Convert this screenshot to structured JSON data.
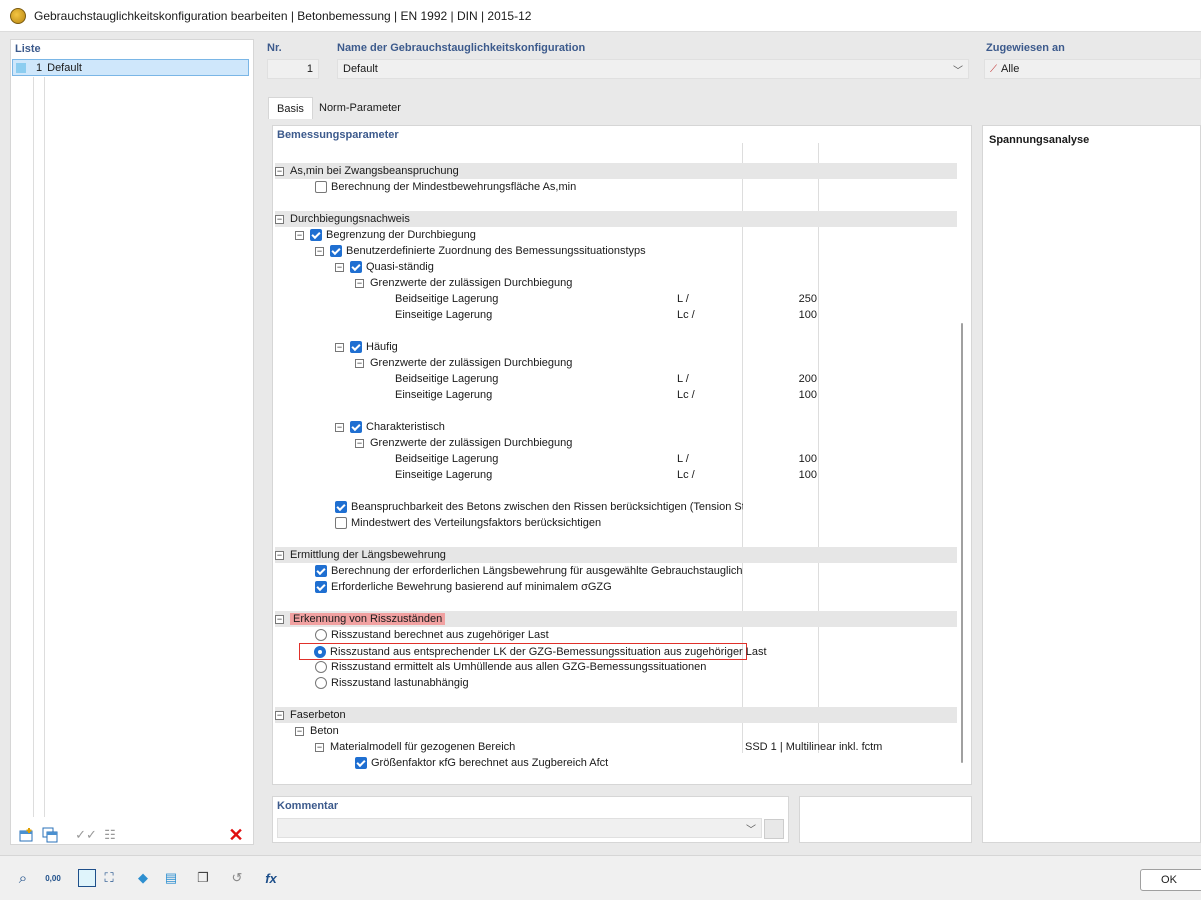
{
  "window": {
    "title": "Gebrauchstauglichkeitskonfiguration bearbeiten | Betonbemessung | EN 1992 | DIN | 2015-12"
  },
  "liste": {
    "header": "Liste",
    "items": [
      {
        "nr": "1",
        "name": "Default"
      }
    ]
  },
  "nr": {
    "header": "Nr.",
    "value": "1"
  },
  "name_config": {
    "header": "Name der Gebrauchstauglichkeitskonfiguration",
    "value": "Default"
  },
  "assigned": {
    "header": "Zugewiesen an",
    "value": "Alle"
  },
  "tabs": [
    "Basis",
    "Norm-Parameter"
  ],
  "section_header": "Bemessungsparameter",
  "right_panel": {
    "title": "Spannungsanalyse"
  },
  "tree": {
    "asmin_group": "As,min bei Zwangsbeanspruchung",
    "asmin_calc": "Berechnung der Mindestbewehrungsfläche As,min",
    "defl_group": "Durchbiegungsnachweis",
    "defl_limit": "Begrenzung der Durchbiegung",
    "user_def": "Benutzerdefinierte Zuordnung des Bemessungssituationstyps",
    "quasi": "Quasi-ständig",
    "grenz": "Grenzwerte der zulässigen Durchbiegung",
    "beid": "Beidseitige Lagerung",
    "einseit": "Einseitige Lagerung",
    "unit_l": "L /",
    "unit_lc": "Lc /",
    "quasi_beid": "250",
    "quasi_einseit": "100",
    "haeufig": "Häufig",
    "haeufig_beid": "200",
    "haeufig_einseit": "100",
    "charakt": "Charakteristisch",
    "charakt_beid": "100",
    "charakt_einseit": "100",
    "tension": "Beanspruchbarkeit des Betons zwischen den Rissen berücksichtigen (Tension Stiffeni",
    "mindest": "Mindestwert des Verteilungsfaktors berücksichtigen",
    "laengs_group": "Ermittlung der Längsbewehrung",
    "laengs_calc": "Berechnung der erforderlichen Längsbewehrung für ausgewählte Gebrauchstauglichkeits",
    "laengs_min": "Erforderliche Bewehrung basierend auf minimalem σGZG",
    "riss_group": "Erkennung von Risszuständen",
    "riss_1": "Risszustand berechnet aus zugehöriger Last",
    "riss_2": "Risszustand aus entsprechender LK der GZG-Bemessungssituation aus zugehöriger Last",
    "riss_3": "Risszustand ermittelt als Umhüllende aus allen GZG-Bemessungssituationen",
    "riss_4": "Risszustand lastunabhängig",
    "faser_group": "Faserbeton",
    "beton": "Beton",
    "material": "Materialmodell für gezogenen Bereich",
    "material_val": "SSD 1 | Multilinear inkl. fctm",
    "groessen": "Größenfaktor κfG berechnet aus Zugbereich Afct"
  },
  "kommentar": {
    "header": "Kommentar",
    "value": ""
  },
  "buttons": {
    "ok": "OK"
  },
  "bottom_toolbar": {
    "units_label": "0,00"
  }
}
